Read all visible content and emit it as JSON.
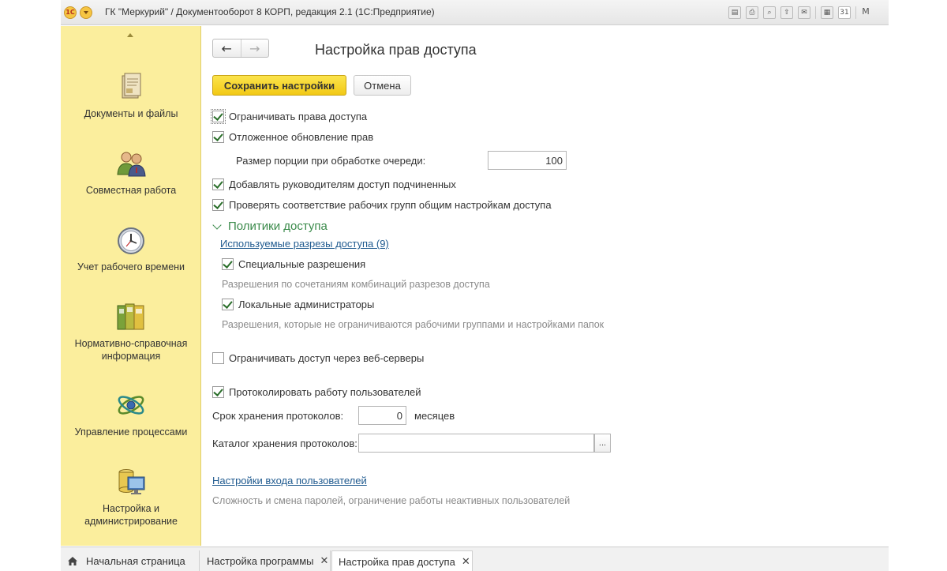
{
  "window": {
    "title": "ГК \"Меркурий\" / Документооборот 8 КОРП, редакция 2.1  (1С:Предприятие)",
    "logo_text": "1С",
    "title_icons": [
      "save-icon",
      "print-icon",
      "preview-icon",
      "export-icon",
      "mail-icon",
      "calculator-icon",
      "calendar-icon",
      "memory-icon"
    ],
    "calendar_day": "31",
    "m_label": "M"
  },
  "sidebar": {
    "items": [
      {
        "label": "Документы и файлы",
        "icon": "documents-icon"
      },
      {
        "label": "Совместная работа",
        "icon": "collaboration-icon"
      },
      {
        "label": "Учет рабочего времени",
        "icon": "clock-icon"
      },
      {
        "label": "Нормативно-справочная информация",
        "icon": "binders-icon"
      },
      {
        "label": "Управление процессами",
        "icon": "process-icon"
      },
      {
        "label": "Настройка и администрирование",
        "icon": "admin-icon"
      }
    ]
  },
  "page": {
    "title": "Настройка прав доступа",
    "save_label": "Сохранить настройки",
    "cancel_label": "Отмена",
    "restrict_access": {
      "label": "Ограничивать права доступа",
      "checked": true
    },
    "deferred_update": {
      "label": "Отложенное обновление прав",
      "checked": true
    },
    "batch_size": {
      "label": "Размер порции при обработке очереди:",
      "value": "100"
    },
    "managers_access": {
      "label": "Добавлять руководителям доступ подчиненных",
      "checked": true
    },
    "check_workgroups": {
      "label": "Проверять соответствие рабочих групп общим настройкам доступа",
      "checked": true
    },
    "policies": {
      "title": "Политики доступа",
      "link": "Используемые разрезы доступа (9)",
      "special_permissions": {
        "label": "Специальные разрешения",
        "checked": true
      },
      "special_hint": "Разрешения по сочетаниям комбинаций разрезов доступа",
      "local_admins": {
        "label": "Локальные администраторы",
        "checked": true
      },
      "local_hint": "Разрешения, которые не ограничиваются рабочими группами и настройками папок"
    },
    "web_servers": {
      "label": "Ограничивать доступ через веб-серверы",
      "checked": false
    },
    "log_users": {
      "label": "Протоколировать работу пользователей",
      "checked": true
    },
    "retention": {
      "label": "Срок хранения протоколов:",
      "value": "0",
      "unit": "месяцев"
    },
    "catalog": {
      "label": "Каталог хранения протоколов:",
      "value": "",
      "button": "..."
    },
    "login_settings_link": "Настройки входа пользователей",
    "login_hint": "Сложность и смена паролей, ограничение работы неактивных пользователей"
  },
  "tabs": [
    {
      "label": "Начальная страница",
      "closable": false,
      "active": false
    },
    {
      "label": "Настройка программы",
      "closable": true,
      "active": false
    },
    {
      "label": "Настройка прав доступа",
      "closable": true,
      "active": true
    }
  ],
  "colors": {
    "sidebar_bg": "#fbee9d",
    "primary_button": "#f2c916",
    "group_title": "#3a8a4a",
    "link": "#1f5a8f"
  }
}
